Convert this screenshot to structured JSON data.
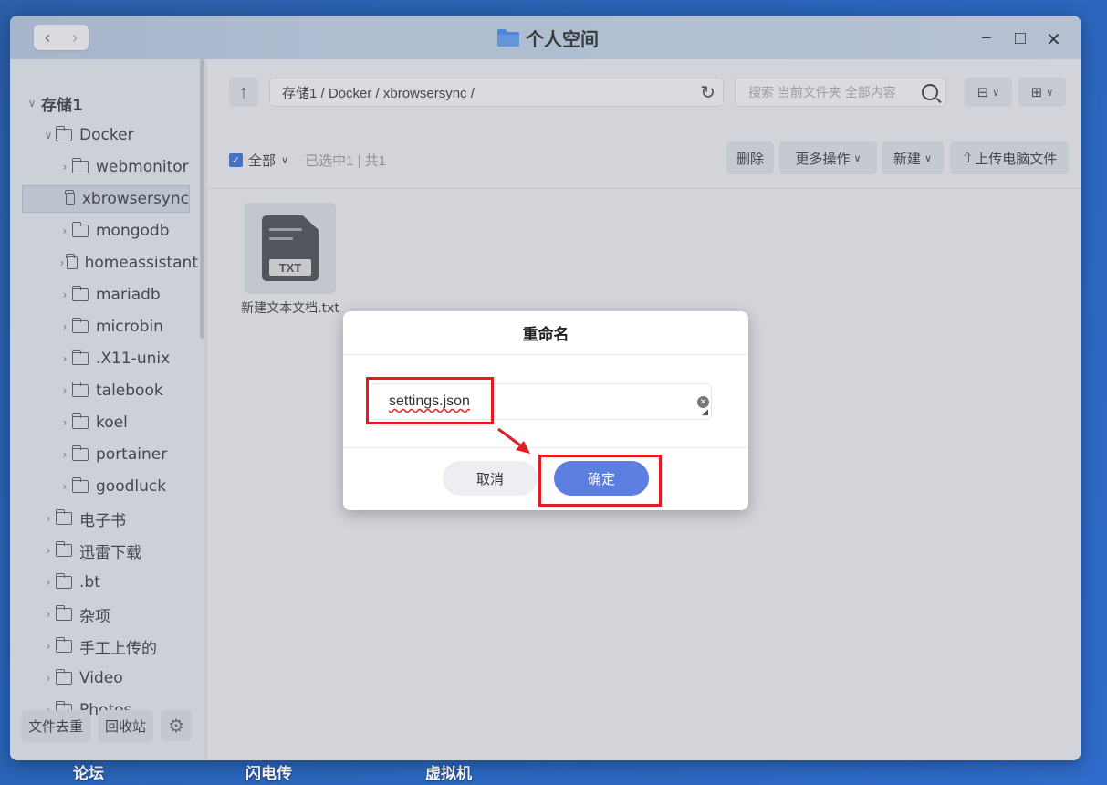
{
  "window": {
    "title": "个人空间",
    "nav_back": "‹",
    "nav_forward": "›",
    "minimize": "−",
    "maximize": "□",
    "close": "✕"
  },
  "sidebar": {
    "items": [
      {
        "label": "存储1",
        "chevron": "∨",
        "level": 0
      },
      {
        "label": "Docker",
        "chevron": "∨",
        "level": 1
      },
      {
        "label": "webmonitor",
        "chevron": "›",
        "level": 2
      },
      {
        "label": "xbrowsersync",
        "chevron": "",
        "level": 2,
        "selected": true
      },
      {
        "label": "mongodb",
        "chevron": "›",
        "level": 2
      },
      {
        "label": "homeassistant",
        "chevron": "›",
        "level": 2
      },
      {
        "label": "mariadb",
        "chevron": "›",
        "level": 2
      },
      {
        "label": "microbin",
        "chevron": "›",
        "level": 2
      },
      {
        "label": ".X11-unix",
        "chevron": "›",
        "level": 2
      },
      {
        "label": "talebook",
        "chevron": "›",
        "level": 2
      },
      {
        "label": "koel",
        "chevron": "›",
        "level": 2
      },
      {
        "label": "portainer",
        "chevron": "›",
        "level": 2
      },
      {
        "label": "goodluck",
        "chevron": "›",
        "level": 2
      },
      {
        "label": "电子书",
        "chevron": "›",
        "level": 1
      },
      {
        "label": "迅雷下载",
        "chevron": "›",
        "level": 1
      },
      {
        "label": ".bt",
        "chevron": "›",
        "level": 1
      },
      {
        "label": "杂项",
        "chevron": "›",
        "level": 1
      },
      {
        "label": "手工上传的",
        "chevron": "›",
        "level": 1
      },
      {
        "label": "Video",
        "chevron": "›",
        "level": 1
      },
      {
        "label": "Photos",
        "chevron": "›",
        "level": 1
      }
    ],
    "dedupe_label": "文件去重",
    "recycle_label": "回收站",
    "settings_icon": "gear-icon"
  },
  "toolbar": {
    "path": "存储1 / Docker / xbrowsersync /",
    "search_placeholder": "搜索 当前文件夹 全部内容",
    "select_all_label": "全部",
    "selection_info": "已选中1 | 共1",
    "delete_label": "删除",
    "more_label": "更多操作",
    "new_label": "新建",
    "upload_label": "上传电脑文件"
  },
  "files": [
    {
      "name": "新建文本文档.txt",
      "type_tag": "TXT"
    }
  ],
  "dialog": {
    "title": "重命名",
    "input_value": "settings.json",
    "cancel_label": "取消",
    "ok_label": "确定"
  },
  "desktop": {
    "labels": [
      "论坛",
      "闪电传",
      "虚拟机"
    ]
  },
  "colors": {
    "accent": "#5b7ee0",
    "annotation_red": "#e31b23",
    "checkbox_blue": "#2f6fe0"
  }
}
